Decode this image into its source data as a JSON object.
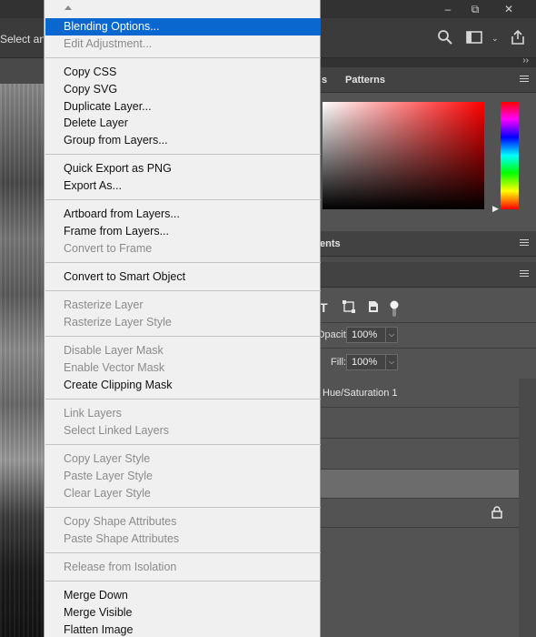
{
  "options_bar": {
    "select_text": "Select and"
  },
  "window_controls": [
    "–",
    "⧉",
    "✕"
  ],
  "panels": {
    "swatches_tab_fragment": "s",
    "patterns_tab": "Patterns",
    "adjustments_tab_fragment": "ents"
  },
  "layers": {
    "opacity_label": "Opacity:",
    "opacity_value": "100%",
    "fill_label": "Fill:",
    "fill_value": "100%",
    "layer_name": "Hue/Saturation 1"
  },
  "menu": {
    "sections": [
      {
        "items": [
          {
            "label": "Blending Options...",
            "enabled": true,
            "selected": true
          },
          {
            "label": "Edit Adjustment...",
            "enabled": false
          }
        ]
      },
      {
        "items": [
          {
            "label": "Copy CSS",
            "enabled": true
          },
          {
            "label": "Copy SVG",
            "enabled": true
          },
          {
            "label": "Duplicate Layer...",
            "enabled": true
          },
          {
            "label": "Delete Layer",
            "enabled": true
          },
          {
            "label": "Group from Layers...",
            "enabled": true
          }
        ]
      },
      {
        "items": [
          {
            "label": "Quick Export as PNG",
            "enabled": true
          },
          {
            "label": "Export As...",
            "enabled": true
          }
        ]
      },
      {
        "items": [
          {
            "label": "Artboard from Layers...",
            "enabled": true
          },
          {
            "label": "Frame from Layers...",
            "enabled": true
          },
          {
            "label": "Convert to Frame",
            "enabled": false
          }
        ]
      },
      {
        "items": [
          {
            "label": "Convert to Smart Object",
            "enabled": true
          }
        ]
      },
      {
        "items": [
          {
            "label": "Rasterize Layer",
            "enabled": false
          },
          {
            "label": "Rasterize Layer Style",
            "enabled": false
          }
        ]
      },
      {
        "items": [
          {
            "label": "Disable Layer Mask",
            "enabled": false
          },
          {
            "label": "Enable Vector Mask",
            "enabled": false
          },
          {
            "label": "Create Clipping Mask",
            "enabled": true
          }
        ]
      },
      {
        "items": [
          {
            "label": "Link Layers",
            "enabled": false
          },
          {
            "label": "Select Linked Layers",
            "enabled": false
          }
        ]
      },
      {
        "items": [
          {
            "label": "Copy Layer Style",
            "enabled": false
          },
          {
            "label": "Paste Layer Style",
            "enabled": false
          },
          {
            "label": "Clear Layer Style",
            "enabled": false
          }
        ]
      },
      {
        "items": [
          {
            "label": "Copy Shape Attributes",
            "enabled": false
          },
          {
            "label": "Paste Shape Attributes",
            "enabled": false
          }
        ]
      },
      {
        "items": [
          {
            "label": "Release from Isolation",
            "enabled": false
          }
        ]
      },
      {
        "items": [
          {
            "label": "Merge Down",
            "enabled": true
          },
          {
            "label": "Merge Visible",
            "enabled": true
          },
          {
            "label": "Flatten Image",
            "enabled": true
          }
        ]
      }
    ]
  }
}
